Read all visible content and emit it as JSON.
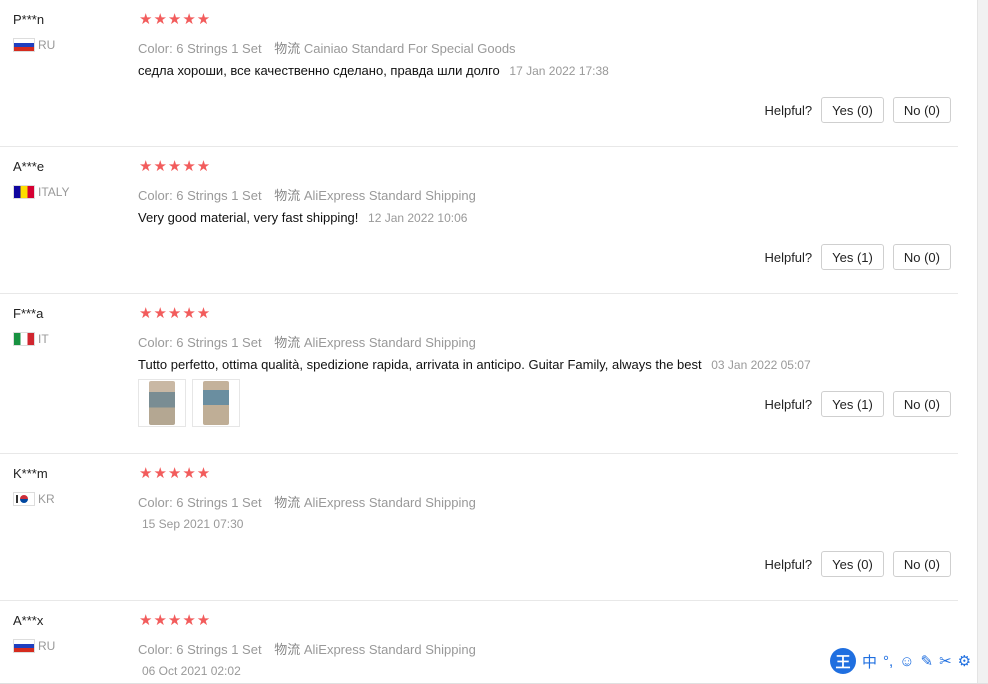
{
  "reviews": [
    {
      "user": "P***n",
      "country": "RU",
      "flag": "flag-ru",
      "stars": "★★★★★",
      "color": "Color: 6 Strings 1 Set",
      "ship_label": "物流",
      "shipping": "Cainiao Standard For Special Goods",
      "text": "седла хороши, все качественно сделано, правда шли долго",
      "date": "17 Jan 2022 17:38",
      "helpful": "Helpful?",
      "yes": "Yes (0)",
      "no": "No (0)"
    },
    {
      "user": "A***e",
      "country": "ITALY",
      "flag": "flag-ad",
      "stars": "★★★★★",
      "color": "Color: 6 Strings 1 Set",
      "ship_label": "物流",
      "shipping": "AliExpress Standard Shipping",
      "text": "Very good material, very fast shipping!",
      "date": "12 Jan 2022 10:06",
      "helpful": "Helpful?",
      "yes": "Yes (1)",
      "no": "No (0)"
    },
    {
      "user": "F***a",
      "country": "IT",
      "flag": "flag-it",
      "stars": "★★★★★",
      "color": "Color: 6 Strings 1 Set",
      "ship_label": "物流",
      "shipping": "AliExpress Standard Shipping",
      "text": "Tutto perfetto, ottima qualità, spedizione rapida, arrivata in anticipo. Guitar Family, always the best",
      "date": "03 Jan 2022 05:07",
      "helpful": "Helpful?",
      "yes": "Yes (1)",
      "no": "No (0)"
    },
    {
      "user": "K***m",
      "country": "KR",
      "flag": "flag-kr",
      "stars": "★★★★★",
      "color": "Color: 6 Strings 1 Set",
      "ship_label": "物流",
      "shipping": "AliExpress Standard Shipping",
      "date": "15 Sep 2021 07:30",
      "helpful": "Helpful?",
      "yes": "Yes (0)",
      "no": "No (0)"
    },
    {
      "user": "A***x",
      "country": "RU",
      "flag": "flag-ru",
      "stars": "★★★★★",
      "color": "Color: 6 Strings 1 Set",
      "ship_label": "物流",
      "shipping": "AliExpress Standard Shipping",
      "date": "06 Oct 2021 02:02"
    }
  ],
  "ime_toolbar": {
    "logo": "王",
    "mode": "中",
    "items": [
      "°,",
      "☺",
      "✎",
      "✂",
      "⚙"
    ]
  },
  "colors": {
    "star": "#f25c5c",
    "meta": "#999999",
    "border": "#cfcfcf"
  }
}
